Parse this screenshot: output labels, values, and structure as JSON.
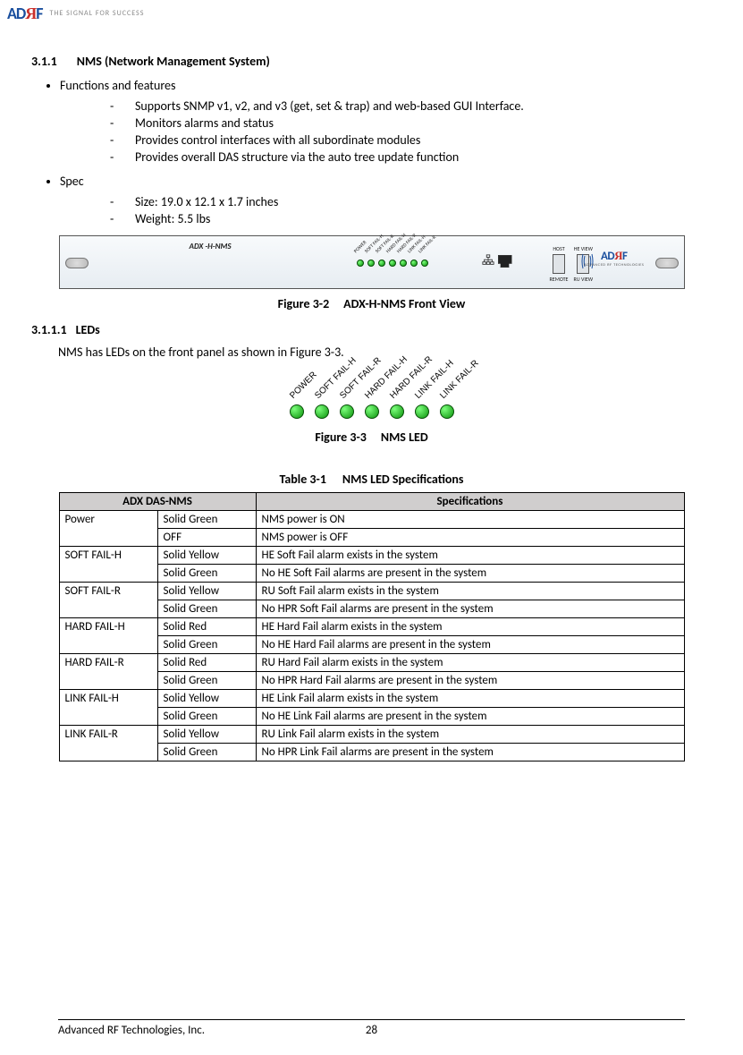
{
  "logo": {
    "brand_a": "AD",
    "brand_r": "Я",
    "brand_f": "F",
    "tagline": "THE SIGNAL FOR SUCCESS"
  },
  "section": {
    "number": "3.1.1",
    "title": "NMS (Network Management System)",
    "functions_label": "Functions and features",
    "functions": [
      "Supports SNMP v1, v2, and v3 (get, set & trap) and web-based GUI Interface.",
      "Monitors alarms and status",
      "Provides control interfaces with all subordinate modules",
      "Provides overall DAS structure via the auto tree update function"
    ],
    "spec_label": "Spec",
    "specs": [
      "Size: 19.0 x 12.1 x 1.7 inches",
      "Weight: 5.5 lbs"
    ]
  },
  "front_panel": {
    "title": "ADX -H-NMS",
    "leds": [
      "POWER",
      "SOFT FAIL-H",
      "SOFT FAIL-R",
      "HARD FAIL-H",
      "HARD FAIL-R",
      "LINK FAIL-H",
      "LINK FAIL-R"
    ],
    "block_tl": "HOST",
    "block_tr": "HE VIEW",
    "block_bl": "REMOTE",
    "block_br": "RU VIEW",
    "logo_small": "ADVANCED RF TECHNOLOGIES"
  },
  "fig32": {
    "num": "Figure 3-2",
    "title": "ADX-H-NMS Front View"
  },
  "leds_section": {
    "number": "3.1.1.1",
    "title": "LEDs",
    "intro": "NMS has LEDs on the front panel as shown in Figure 3-3."
  },
  "nms_led": {
    "labels": [
      "POWER",
      "SOFT FAIL-H",
      "SOFT FAIL-R",
      "HARD FAIL-H",
      "HARD FAIL-R",
      "LINK FAIL-H",
      "LINK FAIL-R"
    ]
  },
  "fig33": {
    "num": "Figure 3-3",
    "title": "NMS LED"
  },
  "table31": {
    "num": "Table 3-1",
    "title": "NMS LED Specifications"
  },
  "table": {
    "h1": "ADX DAS-NMS",
    "h2": "Specifications",
    "rows": [
      {
        "name": "Power",
        "states": [
          [
            "Solid Green",
            "NMS power is ON"
          ],
          [
            "OFF",
            "NMS power is OFF"
          ]
        ]
      },
      {
        "name": "SOFT FAIL-H",
        "states": [
          [
            "Solid Yellow",
            "HE Soft Fail alarm exists in the system"
          ],
          [
            "Solid Green",
            "No HE Soft Fail alarms are present in the system"
          ]
        ]
      },
      {
        "name": "SOFT FAIL-R",
        "states": [
          [
            "Solid Yellow",
            "RU Soft Fail alarm exists in the system"
          ],
          [
            "Solid Green",
            "No HPR Soft Fail alarms are present in the system"
          ]
        ]
      },
      {
        "name": "HARD FAIL-H",
        "states": [
          [
            "Solid Red",
            "HE Hard Fail alarm exists in the system"
          ],
          [
            "Solid Green",
            "No HE Hard Fail alarms are present in the system"
          ]
        ]
      },
      {
        "name": "HARD FAIL-R",
        "states": [
          [
            "Solid Red",
            "RU Hard Fail alarm exists in the system"
          ],
          [
            "Solid Green",
            "No HPR Hard Fail alarms are present in the system"
          ]
        ]
      },
      {
        "name": "LINK FAIL-H",
        "states": [
          [
            "Solid Yellow",
            "HE Link Fail alarm exists in the system"
          ],
          [
            "Solid Green",
            "No HE Link Fail alarms are present in the system"
          ]
        ]
      },
      {
        "name": "LINK FAIL-R",
        "states": [
          [
            "Solid Yellow",
            "RU Link Fail alarm exists in the system"
          ],
          [
            "Solid Green",
            "No HPR Link Fail alarms are present in the system"
          ]
        ]
      }
    ]
  },
  "footer": {
    "company": "Advanced RF Technologies, Inc.",
    "page": "28"
  }
}
